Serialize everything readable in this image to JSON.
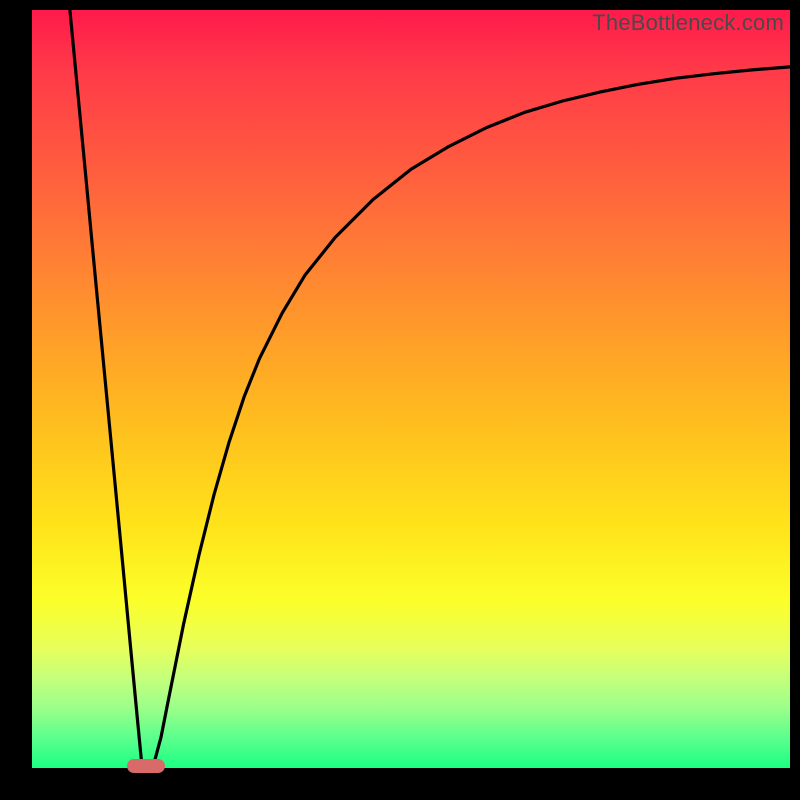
{
  "watermark": "TheBottleneck.com",
  "colors": {
    "frame": "#000000",
    "curve": "#000000",
    "marker": "#d86a6a",
    "gradient_stops": [
      "#ff1a4b",
      "#ff3a49",
      "#ff5a3f",
      "#ff7d35",
      "#ffa028",
      "#ffc21e",
      "#ffe31a",
      "#fbff2a",
      "#e8ff5a",
      "#c6ff7a",
      "#9cff8a",
      "#5cff8c",
      "#1cff84"
    ]
  },
  "chart_data": {
    "type": "line",
    "title": "",
    "xlabel": "",
    "ylabel": "",
    "xlim": [
      0,
      100
    ],
    "ylim": [
      0,
      100
    ],
    "grid": false,
    "legend": false,
    "annotations": [
      {
        "kind": "marker-pill",
        "x": 15,
        "y": 0,
        "color": "#d86a6a"
      }
    ],
    "series": [
      {
        "name": "left-branch",
        "x": [
          5.0,
          6.0,
          7.0,
          8.0,
          9.0,
          10.0,
          11.0,
          12.0,
          13.0,
          14.0,
          14.5
        ],
        "y": [
          100.0,
          89.5,
          79.0,
          68.5,
          58.0,
          47.5,
          37.0,
          26.5,
          16.0,
          5.5,
          0.3
        ]
      },
      {
        "name": "right-branch",
        "x": [
          16.0,
          17.0,
          18.0,
          19.0,
          20.0,
          22.0,
          24.0,
          26.0,
          28.0,
          30.0,
          33.0,
          36.0,
          40.0,
          45.0,
          50.0,
          55.0,
          60.0,
          65.0,
          70.0,
          75.0,
          80.0,
          85.0,
          90.0,
          95.0,
          100.0
        ],
        "y": [
          0.3,
          4.0,
          9.0,
          14.0,
          19.0,
          28.0,
          36.0,
          43.0,
          49.0,
          54.0,
          60.0,
          65.0,
          70.0,
          75.0,
          79.0,
          82.0,
          84.5,
          86.5,
          88.0,
          89.2,
          90.2,
          91.0,
          91.6,
          92.1,
          92.5
        ]
      }
    ],
    "notes": "x and y are percentages of the plot area; y=0 is the bottom (green), y=100 is the top (red). Curve values estimated from pixel positions since no axes/ticks are rendered."
  }
}
